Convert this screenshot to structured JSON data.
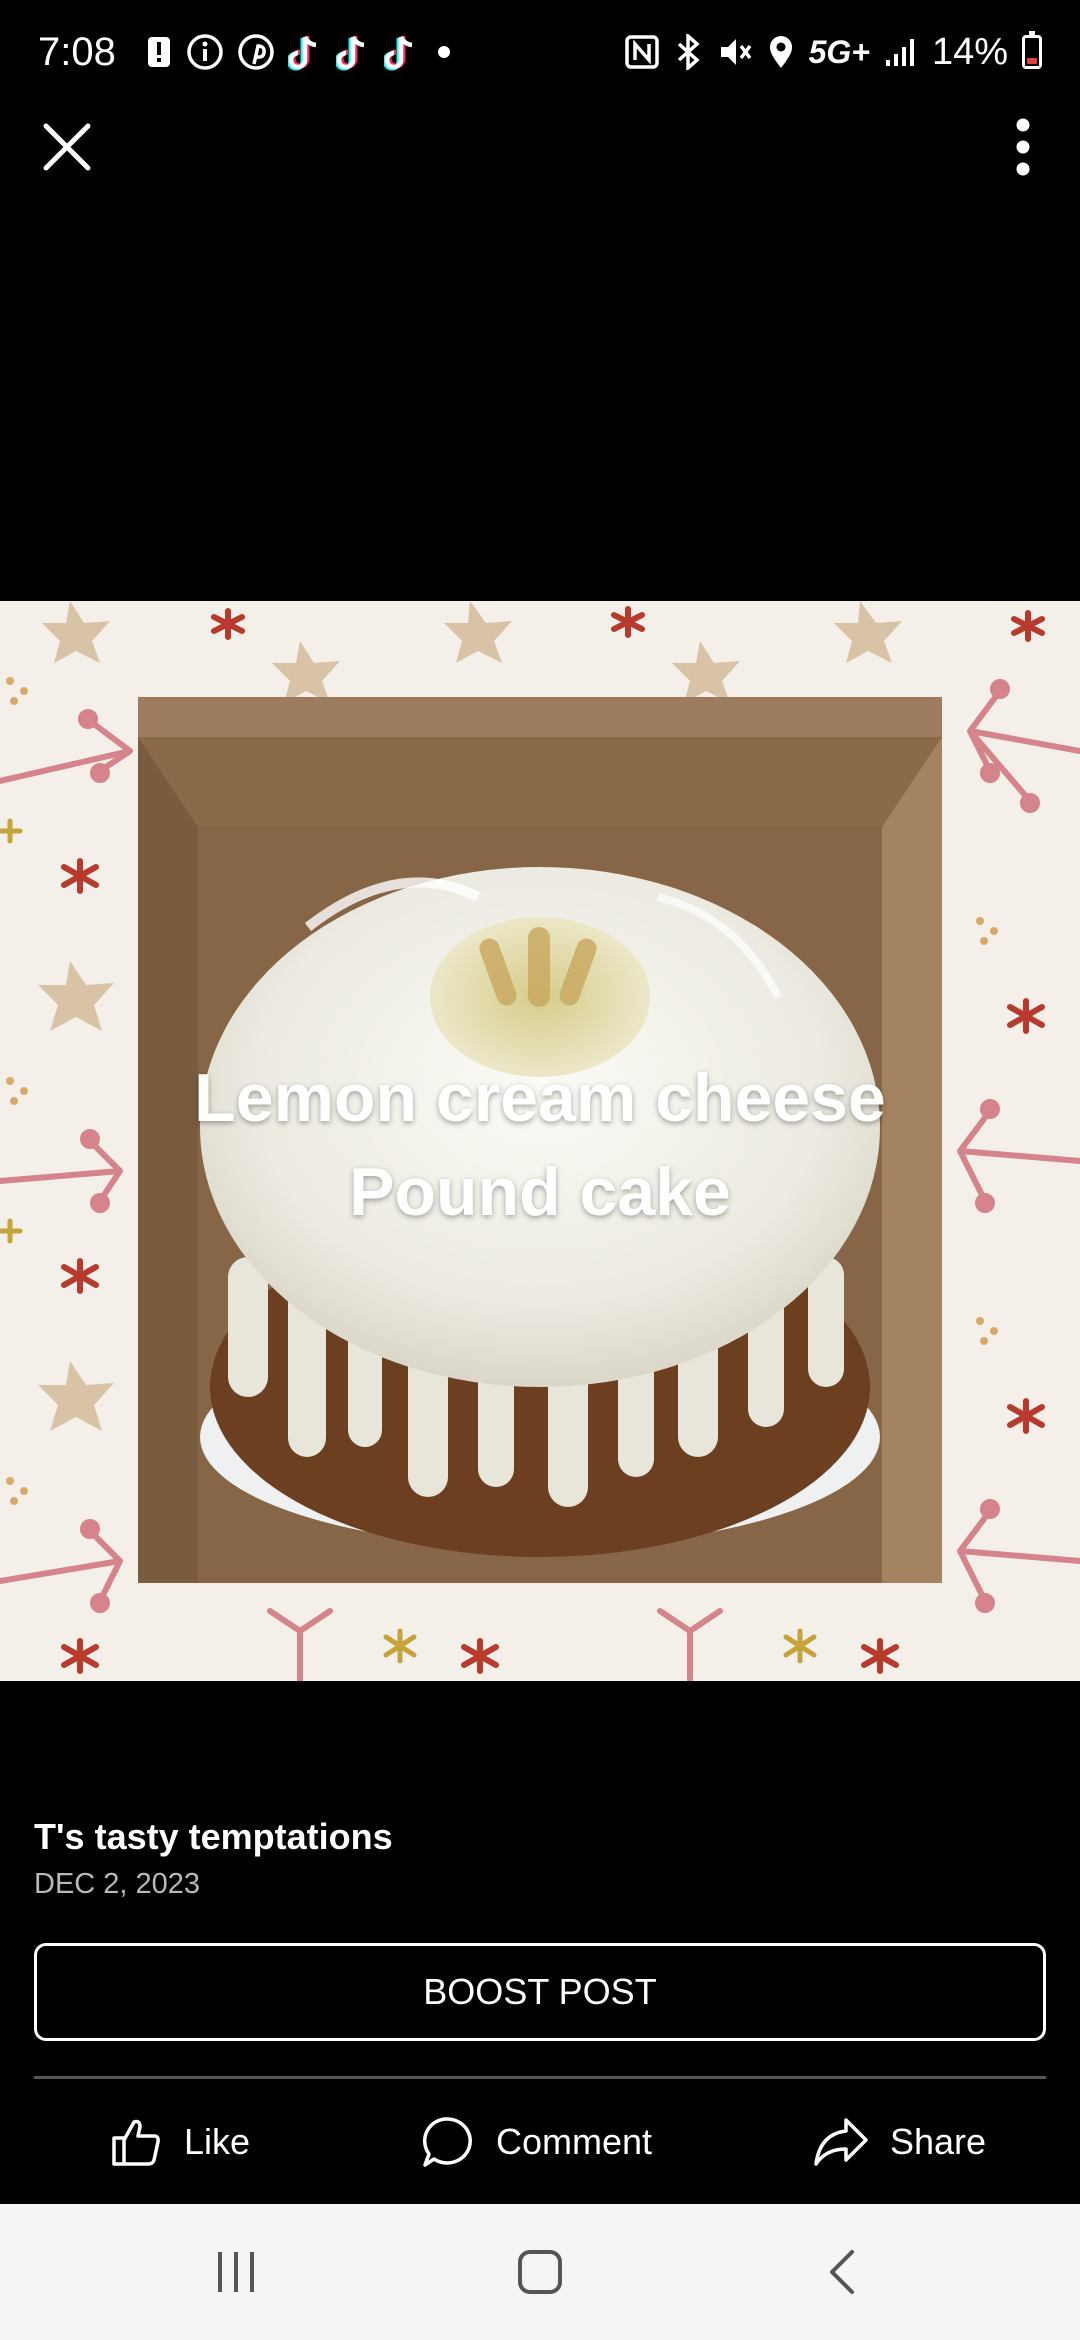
{
  "status_bar": {
    "time": "7:08",
    "network": "5G+",
    "battery_percent": "14%",
    "battery_level": 0.14,
    "left_icons": [
      "alert-icon",
      "info-icon",
      "pinterest-icon",
      "tiktok-icon",
      "tiktok-icon",
      "tiktok-icon",
      "dot-icon"
    ],
    "right_icons": [
      "nfc-icon",
      "bluetooth-icon",
      "mute-icon",
      "location-icon",
      "signal-icon",
      "battery-icon"
    ]
  },
  "toolbar": {
    "close_icon": "close-icon",
    "more_icon": "more-vertical-icon"
  },
  "photo": {
    "caption_line1": "Lemon cream cheese",
    "caption_line2": "Pound cake",
    "background_color": "#f4efe9"
  },
  "post": {
    "author": "T's tasty temptations",
    "date": "DEC 2, 2023",
    "boost_label": "BOOST POST"
  },
  "actions": {
    "like_label": "Like",
    "comment_label": "Comment",
    "share_label": "Share"
  },
  "nav_bar": {
    "recents_icon": "recents-icon",
    "home_icon": "home-icon",
    "back_icon": "back-icon"
  },
  "colors": {
    "background": "#000000",
    "text": "#ffffff",
    "date_text": "#b8b8b8",
    "divider": "#555555",
    "nav_bar": "#f5f5f7",
    "battery_low": "#e0443a"
  }
}
